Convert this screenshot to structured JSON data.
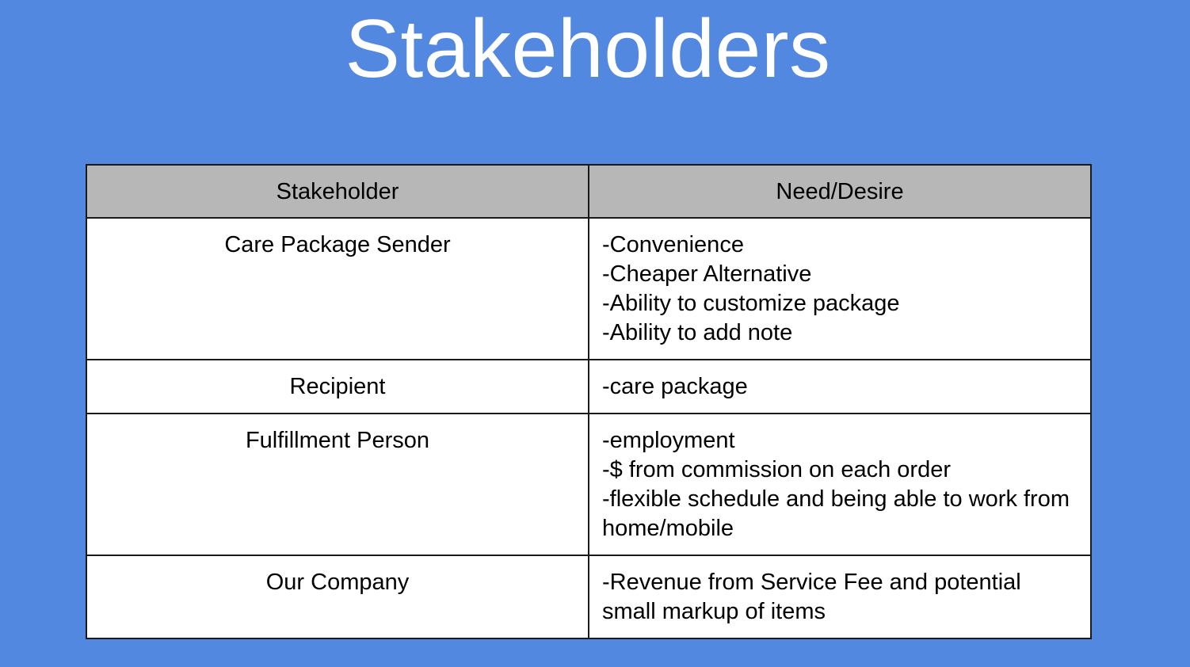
{
  "slide": {
    "title": "Stakeholders"
  },
  "table": {
    "headers": [
      "Stakeholder",
      "Need/Desire"
    ],
    "rows": [
      {
        "stakeholder": "Care Package Sender",
        "needs": [
          "-Convenience",
          "-Cheaper Alternative",
          "-Ability to customize package",
          "-Ability to add note"
        ]
      },
      {
        "stakeholder": "Recipient",
        "needs": [
          "-care package"
        ]
      },
      {
        "stakeholder": "Fulfillment Person",
        "needs": [
          "-employment",
          "-$ from commission on each order",
          "-flexible schedule and being able to work from home/mobile"
        ]
      },
      {
        "stakeholder": "Our Company",
        "needs": [
          "-Revenue from Service Fee and potential small markup of items"
        ]
      }
    ]
  },
  "colors": {
    "background": "#5388e1",
    "header_fill": "#b7b7b7",
    "cell_fill": "#ffffff",
    "border": "#1a1a1a",
    "title_text": "#ffffff"
  }
}
